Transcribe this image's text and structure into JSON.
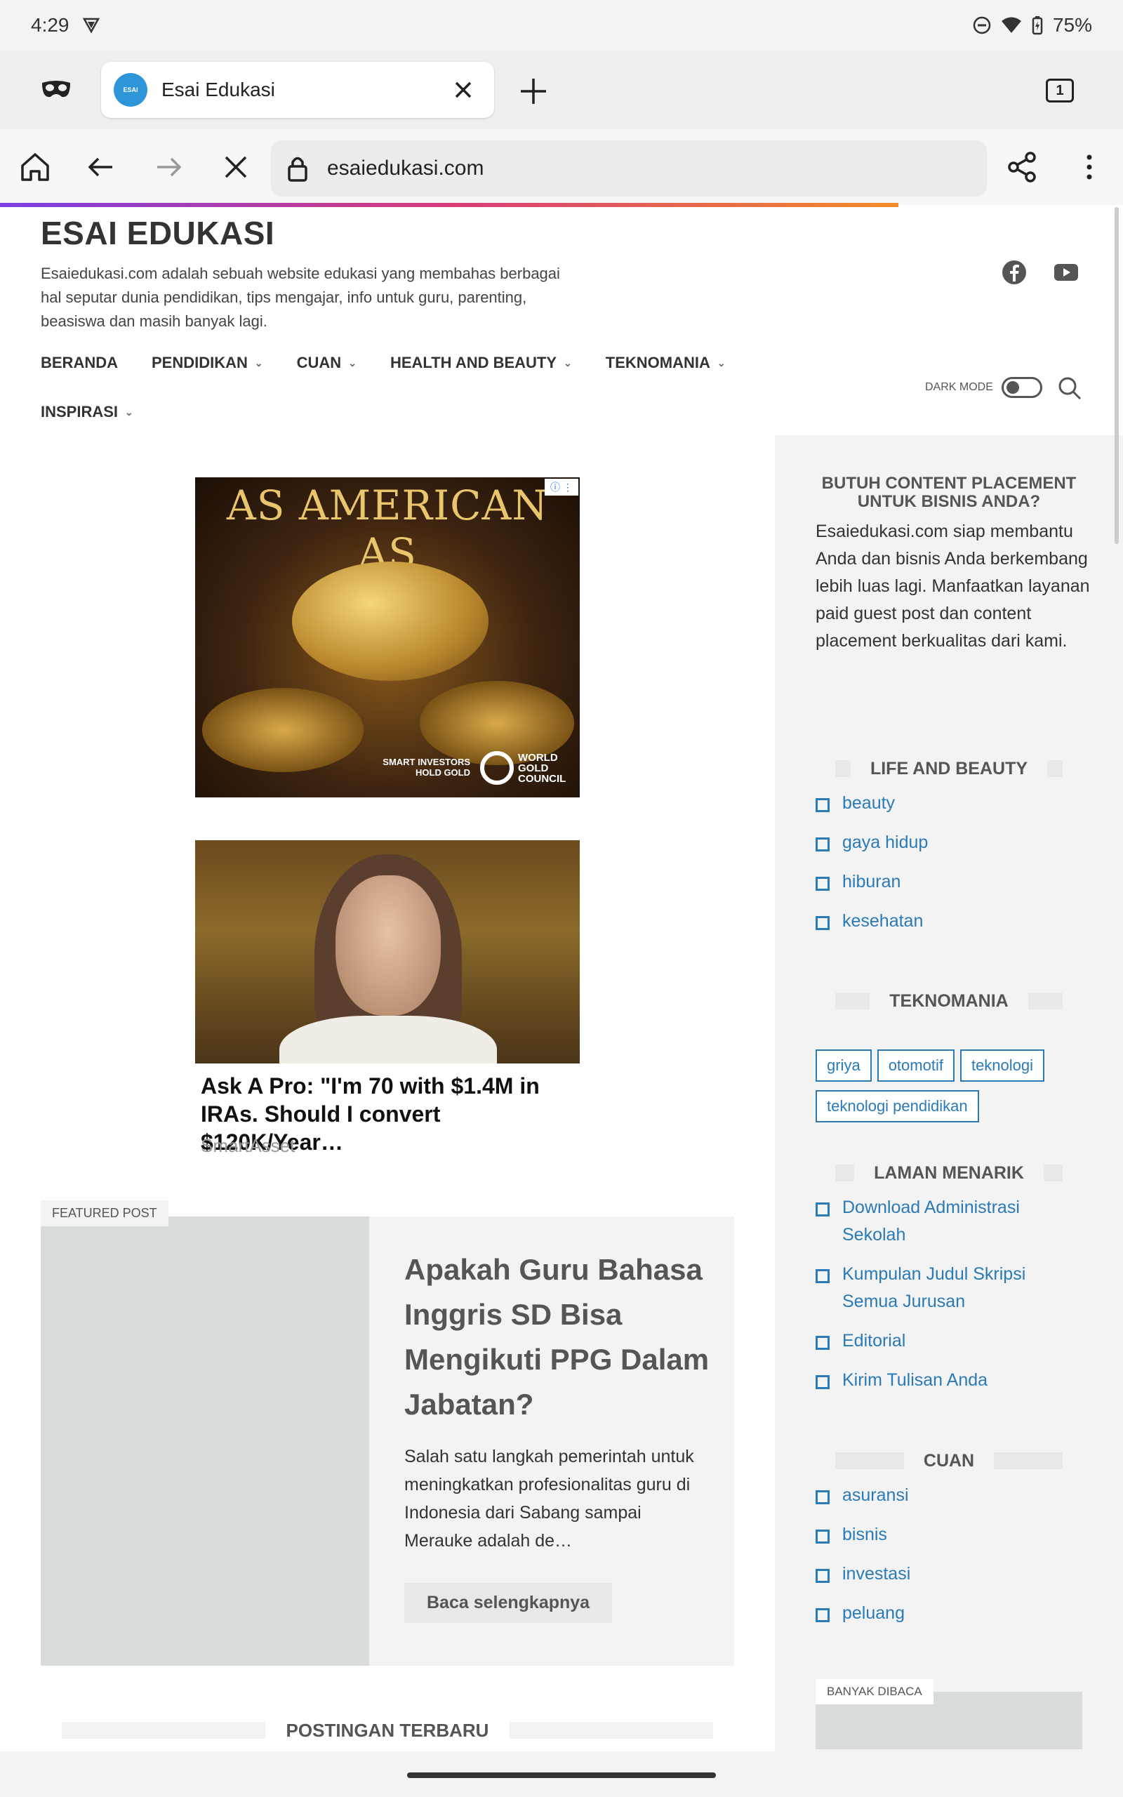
{
  "status_bar": {
    "time": "4:29",
    "battery": "75%"
  },
  "browser": {
    "tab_title": "Esai Edukasi",
    "tab_count": "1",
    "url": "esaiedukasi.com",
    "favicon_text": "ESAI"
  },
  "site": {
    "title": "ESAI EDUKASI",
    "description": "Esaiedukasi.com adalah sebuah website edukasi yang membahas berbagai hal seputar dunia pendidikan, tips mengajar, info untuk guru, parenting, beasiswa dan masih banyak lagi.",
    "nav": [
      "BERANDA",
      "PENDIDIKAN",
      "CUAN",
      "HEALTH AND BEAUTY",
      "TEKNOMANIA",
      "INSPIRASI"
    ],
    "dark_mode_label": "DARK MODE"
  },
  "ads": {
    "ad1_headline": "AS AMERICAN AS",
    "ad1_note": "SMART INVESTORS HOLD GOLD",
    "ad1_brand": "WORLD GOLD COUNCIL",
    "ad2_headline": "Ask A Pro: \"I'm 70 with $1.4M in IRAs. Should I convert $120K/Year…",
    "ad2_source": "SmartAsset"
  },
  "featured": {
    "tag": "FEATURED POST",
    "title": "Apakah Guru Bahasa Inggris SD Bisa Mengikuti PPG Dalam Jabatan?",
    "excerpt": "Salah satu langkah pemerintah untuk meningkatkan profesionalitas guru di Indonesia dari Sabang sampai Merauke adalah de…",
    "read_more": "Baca selengkapnya"
  },
  "latest_title": "POSTINGAN TERBARU",
  "sidebar": {
    "promo_title": "BUTUH CONTENT PLACEMENT UNTUK BISNIS ANDA?",
    "promo_text": "Esaiedukasi.com siap membantu Anda dan bisnis Anda berkembang lebih luas lagi. Manfaatkan layanan paid guest post dan content placement berkualitas dari kami.",
    "life_title": "LIFE AND BEAUTY",
    "life_items": [
      "beauty",
      "gaya hidup",
      "hiburan",
      "kesehatan"
    ],
    "tekno_title": "TEKNOMANIA",
    "tekno_tags": [
      "griya",
      "otomotif",
      "teknologi",
      "teknologi pendidikan"
    ],
    "laman_title": "LAMAN MENARIK",
    "laman_items": [
      "Download Administrasi Sekolah",
      "Kumpulan Judul Skripsi Semua Jurusan",
      "Editorial",
      "Kirim Tulisan Anda"
    ],
    "cuan_title": "CUAN",
    "cuan_items": [
      "asuransi",
      "bisnis",
      "investasi",
      "peluang"
    ],
    "popular_tag": "BANYAK DIBACA"
  },
  "colors": {
    "link": "#2a7ab8",
    "sidebar_bg": "#f3f3f3",
    "text": "#333333"
  }
}
